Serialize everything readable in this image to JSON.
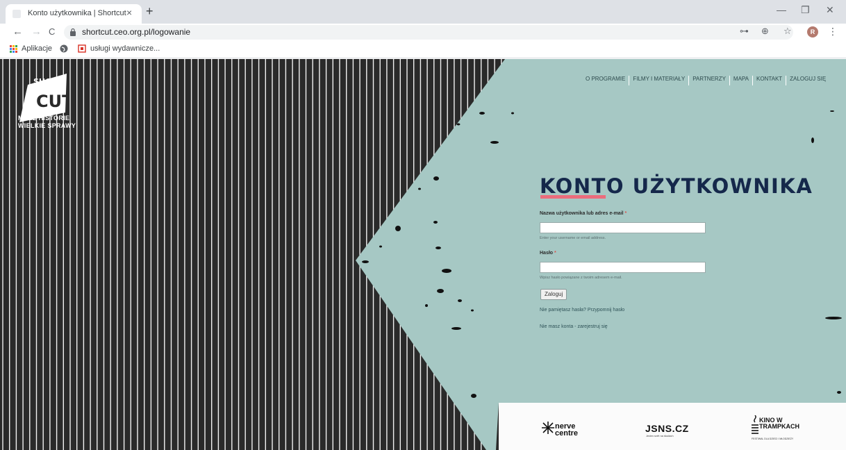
{
  "browser": {
    "tab_title": "Konto użytkownika | Shortcut",
    "tab_close": "×",
    "new_tab": "+",
    "url": "shortcut.ceo.org.pl/logowanie",
    "avatar_letter": "R",
    "controls": {
      "minimize": "—",
      "maximize": "❐",
      "close": "✕"
    },
    "nav": {
      "back": "←",
      "forward": "→",
      "reload": "C"
    },
    "icons": {
      "key": "⊶",
      "zoom": "⊕",
      "star": "☆",
      "menu": "⋮"
    },
    "bookmarks": [
      {
        "label": "Aplikacje",
        "icon": "apps-grid-icon"
      },
      {
        "label": "",
        "icon": "globe-icon"
      },
      {
        "label": "usługi wydawnicze...",
        "icon": "bookmark-page-icon"
      }
    ]
  },
  "site": {
    "logo": {
      "short": "SHORT",
      "cut": "CUT",
      "tagline_1": "MAŁE HISTORIE",
      "tagline_2": "WIELKIE SPRAWY"
    },
    "nav": [
      "O PROGRAMIE",
      "FILMY I MATERIAŁY",
      "PARTNERZY",
      "MAPA",
      "KONTAKT",
      "ZALOGUJ SIĘ"
    ],
    "heading": "KONTO UŻYTKOWNIKA",
    "form": {
      "username_label": "Nazwa użytkownika lub adres e-mail",
      "required_mark": "*",
      "username_hint": "Enter your username or email address.",
      "username_value": "",
      "password_label": "Hasło",
      "password_hint": "Wpisz hasło powiązane z twoim adresem e-mail.",
      "password_value": "",
      "submit": "Zaloguj"
    },
    "links": {
      "forgot": "Nie pamiętasz hasła? Przypomnij hasło",
      "register": "Nie masz konta - zarejestruj się"
    },
    "partners": {
      "nerve_1": "nerve",
      "nerve_2": "centre",
      "jsns": "JSNS.CZ",
      "jsns_sub": "Jeden svět na školách",
      "kino_1": "KINO W",
      "kino_2": "TRAMPKACH",
      "kino_sub": "FESTIWAL DLA DZIECI I MŁODZIEŻY"
    },
    "colors": {
      "teal": "#a6c8c4",
      "navy": "#15284b",
      "pink": "#ec6c7c",
      "dark": "#2a2a2a"
    }
  }
}
